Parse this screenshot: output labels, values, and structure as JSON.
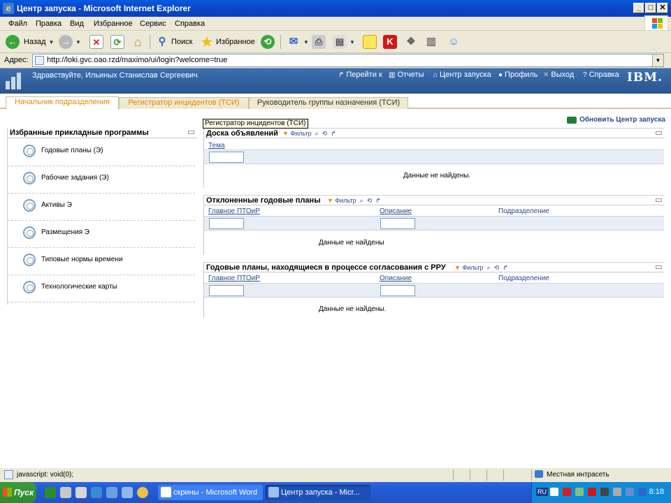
{
  "window": {
    "title": "Центр запуска - Microsoft Internet Explorer",
    "min": "_",
    "max": "□",
    "close": "✕"
  },
  "menu": [
    "Файл",
    "Правка",
    "Вид",
    "Избранное",
    "Сервис",
    "Справка"
  ],
  "toolbar": {
    "back": "Назад",
    "search": "Поиск",
    "favorites": "Избранное"
  },
  "address": {
    "label": "Адрес:",
    "url": "http://loki.gvc.oao.rzd/maximo/ui/login?welcome=true"
  },
  "banner": {
    "greeting": "Здравствуйте, Ильиных Станислав Сергеевич",
    "nav": [
      "Перейти к",
      "Отчеты",
      "Центр запуска",
      "Профиль",
      "Выход",
      "Справка"
    ],
    "brand": "IBM."
  },
  "tabs": [
    "Начальник подразделения",
    "Регистратор инцидентов (ТСИ)",
    "Руководитель группы назначения (ТСИ)"
  ],
  "tooltip": "Регистратор инцидентов (ТСИ)",
  "refresh_label": "Обновить Центр запуска",
  "favorites": {
    "title": "Избранные прикладные программы",
    "items": [
      "Годовые планы (Э)",
      "Рабочие задания (Э)",
      "Активы Э",
      "Размещения Э",
      "Типовые нормы времени",
      "Технологические карты"
    ]
  },
  "portlets": {
    "board": {
      "title": "Доска объявлений",
      "filter": "Фильтр",
      "col1": "Тема",
      "nodata": "Данные не найдены."
    },
    "rejected": {
      "title": "Отклоненные годовые планы",
      "filter": "Фильтр",
      "col1": "Главное ПТОиР",
      "col2": "Описание",
      "col3": "Подразделение",
      "nodata": "Данные не найдены"
    },
    "approval": {
      "title": "Годовые планы, находящиеся в процессе согласования с РРУ",
      "filter": "Фильтр",
      "col1": "Главное ПТОиР",
      "col2": "Описание",
      "col3": "Подразделение",
      "nodata": "Данные не найдены."
    }
  },
  "status": {
    "text": "javascript: void(0);",
    "zone": "Местная интрасеть"
  },
  "taskbar": {
    "start": "Пуск",
    "items": [
      "скрины - Microsoft Word",
      "Центр запуска - Micr..."
    ],
    "lang": "RU",
    "clock": "8:18"
  }
}
